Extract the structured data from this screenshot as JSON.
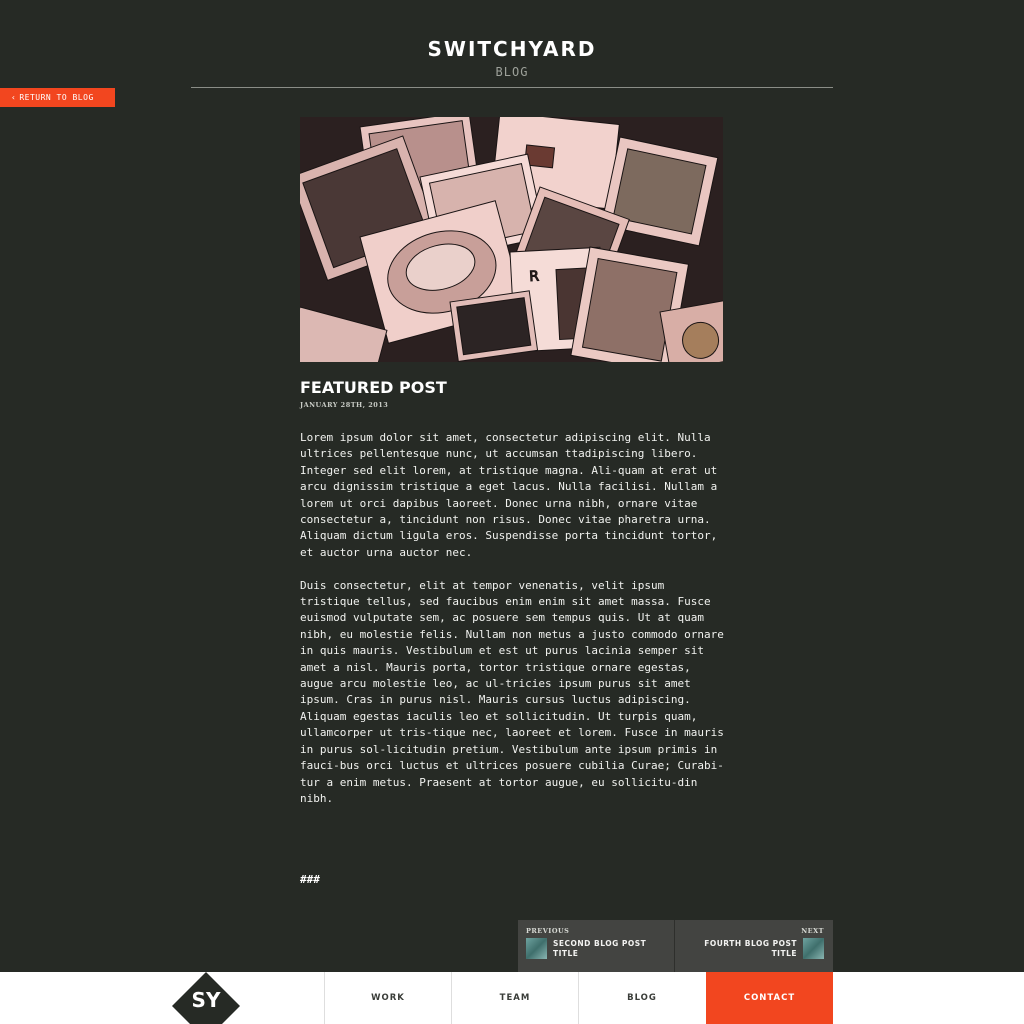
{
  "header": {
    "site_title": "SWITCHYARD",
    "site_subtitle": "BLOG"
  },
  "return_button": {
    "label": "RETURN TO BLOG",
    "icon": "chevron-left-icon"
  },
  "post": {
    "title": "FEATURED POST",
    "date": "JANUARY 28TH, 2013",
    "paragraphs": [
      "Lorem ipsum dolor sit amet, consectetur adipiscing elit. Nulla ultrices pellentesque nunc, ut accumsan ttadipiscing libero. Integer sed elit lorem, at tristique magna. Ali-quam at erat ut arcu dignissim tristique a eget lacus. Nulla facilisi. Nullam a lorem ut orci dapibus laoreet. Donec urna nibh, ornare vitae consectetur a, tincidunt non risus. Donec vitae pharetra urna. Aliquam dictum ligula eros. Suspendisse porta tincidunt tortor, et auctor urna auctor nec.",
      "Duis consectetur, elit at tempor venenatis, velit ipsum tristique tellus, sed faucibus enim enim sit amet massa. Fusce euismod vulputate sem, ac posuere sem tempus quis. Ut at quam nibh, eu molestie felis. Nullam non metus a justo commodo ornare in quis mauris. Vestibulum et est ut purus lacinia semper sit amet a nisl. Mauris porta, tortor tristique ornare egestas, augue arcu molestie leo, ac ul-tricies ipsum purus sit amet ipsum. Cras in purus nisl. Mauris cursus luctus adipiscing. Aliquam egestas iaculis leo et sollicitudin. Ut turpis quam, ullamcorper ut tris-tique nec, laoreet et lorem. Fusce in mauris in purus sol-licitudin pretium. Vestibulum ante ipsum primis in fauci-bus orci luctus et ultrices posuere cubilia Curae; Curabi-tur a enim metus. Praesent at tortor augue, eu sollicitu-din nibh."
    ],
    "end_mark": "###"
  },
  "post_nav": {
    "previous": {
      "label": "PREVIOUS",
      "title": "SECOND BLOG POST TITLE"
    },
    "next": {
      "label": "NEXT",
      "title": "FOURTH BLOG POST TITLE"
    }
  },
  "footer": {
    "logo_text": "SY",
    "nav": [
      {
        "label": "WORK"
      },
      {
        "label": "TEAM"
      },
      {
        "label": "BLOG"
      },
      {
        "label": "CONTACT"
      }
    ]
  },
  "colors": {
    "background": "#262a25",
    "accent": "#f2461f",
    "footer_bg": "#ffffff",
    "post_nav_bg": "#434441"
  }
}
